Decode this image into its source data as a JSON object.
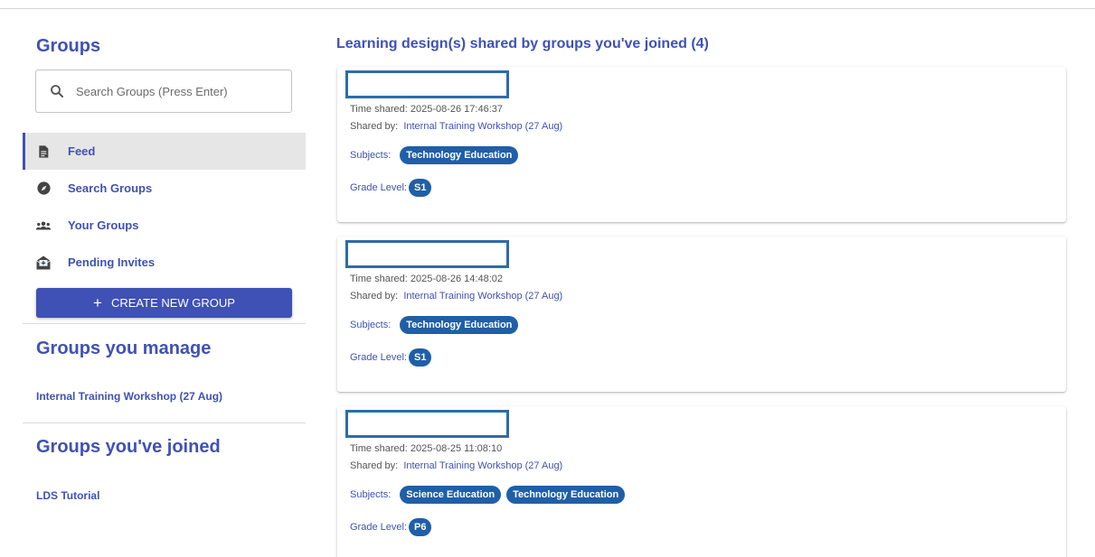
{
  "sidebar": {
    "title": "Groups",
    "search_placeholder": "Search Groups (Press Enter)",
    "nav": [
      {
        "label": "Feed",
        "icon": "document-icon",
        "active": true
      },
      {
        "label": "Search Groups",
        "icon": "compass-icon",
        "active": false
      },
      {
        "label": "Your Groups",
        "icon": "people-icon",
        "active": false
      },
      {
        "label": "Pending Invites",
        "icon": "mail-invite-icon",
        "active": false
      }
    ],
    "create_button": "CREATE NEW GROUP",
    "manage_title": "Groups you manage",
    "manage_groups": [
      "Internal Training Workshop (27 Aug)"
    ],
    "joined_title": "Groups you've joined",
    "joined_groups": [
      "LDS Tutorial"
    ]
  },
  "main": {
    "title": "Learning design(s) shared by groups you've joined (4)",
    "labels": {
      "time_shared": "Time shared:",
      "shared_by": "Shared by:",
      "subjects": "Subjects:",
      "grade_level": "Grade Level:"
    },
    "cards": [
      {
        "time": "2025-08-26 17:46:37",
        "shared_by": "Internal Training Workshop (27 Aug)",
        "subjects": [
          "Technology Education"
        ],
        "grade": "S1"
      },
      {
        "time": "2025-08-26 14:48:02",
        "shared_by": "Internal Training Workshop (27 Aug)",
        "subjects": [
          "Technology Education"
        ],
        "grade": "S1"
      },
      {
        "time": "2025-08-25 11:08:10",
        "shared_by": "Internal Training Workshop (27 Aug)",
        "subjects": [
          "Science Education",
          "Technology Education"
        ],
        "grade": "P6"
      }
    ]
  },
  "colors": {
    "accent": "#3f51b5",
    "chip": "#1f5fa8",
    "redaction_border": "#2e6ca8"
  }
}
